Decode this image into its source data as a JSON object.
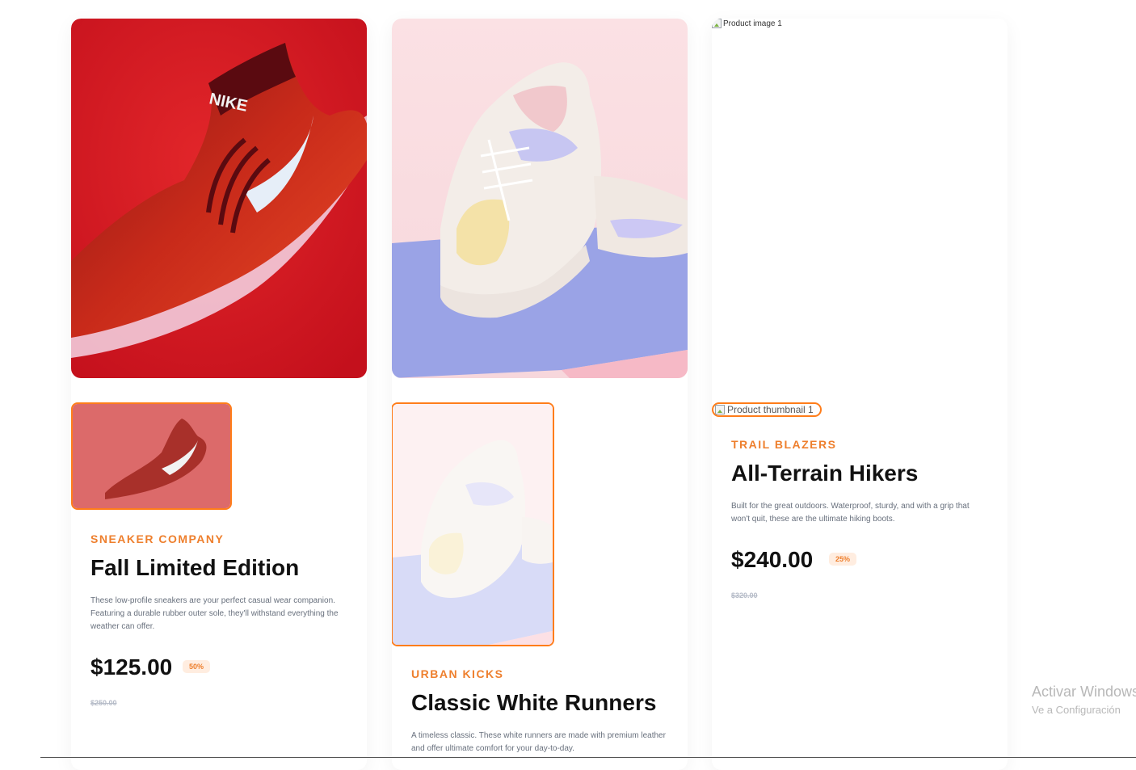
{
  "colors": {
    "accent": "#ee7f2d",
    "thumb_border": "#ff7d1a",
    "badge_bg": "#ffede0",
    "text_dark": "#111111",
    "text_muted": "#68707d",
    "old_price": "#b6bcc8"
  },
  "products": [
    {
      "company": "SNEAKER COMPANY",
      "title": "Fall Limited Edition",
      "description": "These low-profile sneakers are your perfect casual wear companion. Featuring a durable rubber outer sole, they'll withstand everything the weather can offer.",
      "price": "$125.00",
      "discount": "50%",
      "old_price": "$250.00"
    },
    {
      "company": "URBAN KICKS",
      "title": "Classic White Runners",
      "description": "A timeless classic. These white runners are made with premium leather and offer ultimate comfort for your day-to-day."
    },
    {
      "image_alt": "Product image 1",
      "thumbnail_alt": "Product thumbnail 1",
      "company": "TRAIL BLAZERS",
      "title": "All-Terrain Hikers",
      "description": "Built for the great outdoors. Waterproof, sturdy, and with a grip that won't quit, these are the ultimate hiking boots.",
      "price": "$240.00",
      "discount": "25%",
      "old_price": "$320.00"
    }
  ],
  "watermark": {
    "line1": "Activar Windows",
    "line2": "Ve a Configuración"
  }
}
